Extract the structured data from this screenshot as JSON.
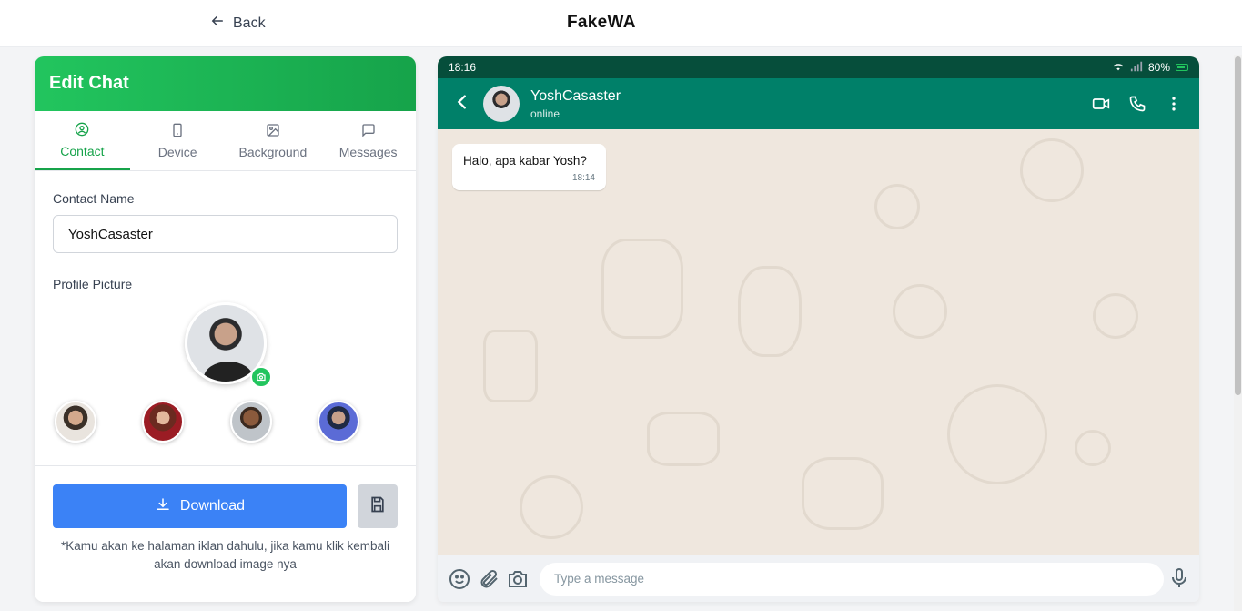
{
  "header": {
    "back_label": "Back",
    "brand": "FakeWA"
  },
  "editor": {
    "title": "Edit Chat",
    "tabs": [
      {
        "label": "Contact",
        "icon": "user-circle-icon",
        "active": true
      },
      {
        "label": "Device",
        "icon": "smartphone-icon",
        "active": false
      },
      {
        "label": "Background",
        "icon": "image-icon",
        "active": false
      },
      {
        "label": "Messages",
        "icon": "message-square-icon",
        "active": false
      }
    ],
    "contact_name_label": "Contact Name",
    "contact_name_value": "YoshCasaster",
    "profile_picture_label": "Profile Picture",
    "download_label": "Download",
    "note": "*Kamu akan ke halaman iklan dahulu, jika kamu klik kembali akan download image nya"
  },
  "phone": {
    "time": "18:16",
    "battery": "80%",
    "contact_name": "YoshCasaster",
    "contact_status": "online",
    "messages": [
      {
        "text": "Halo, apa kabar Yosh?",
        "time": "18:14"
      }
    ],
    "input_placeholder": "Type a message"
  },
  "colors": {
    "brand_green": "#22c55e",
    "wa_header": "#008069",
    "status_bar": "#064e3b",
    "download_blue": "#3b82f6",
    "chat_bg": "#efe7de"
  }
}
